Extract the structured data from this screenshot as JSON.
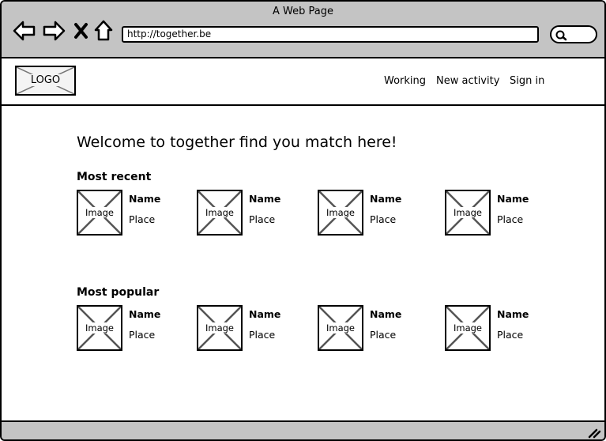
{
  "browser": {
    "title": "A Web Page",
    "url": "http://together.be",
    "icons": [
      "back-arrow-icon",
      "forward-arrow-icon",
      "close-x-icon",
      "home-icon",
      "search-icon",
      "resize-grip-icon"
    ]
  },
  "header": {
    "logo_text": "LOGO",
    "nav": [
      "Working",
      "New activity",
      "Sign in"
    ]
  },
  "main": {
    "headline": "Welcome to together find you match here!",
    "sections": [
      {
        "title": "Most recent",
        "cards": [
          {
            "image_label": "Image",
            "name": "Name",
            "place": "Place"
          },
          {
            "image_label": "Image",
            "name": "Name",
            "place": "Place"
          },
          {
            "image_label": "Image",
            "name": "Name",
            "place": "Place"
          },
          {
            "image_label": "Image",
            "name": "Name",
            "place": "Place"
          }
        ]
      },
      {
        "title": "Most popular",
        "cards": [
          {
            "image_label": "Image",
            "name": "Name",
            "place": "Place"
          },
          {
            "image_label": "Image",
            "name": "Name",
            "place": "Place"
          },
          {
            "image_label": "Image",
            "name": "Name",
            "place": "Place"
          },
          {
            "image_label": "Image",
            "name": "Name",
            "place": "Place"
          }
        ]
      }
    ]
  },
  "colors": {
    "chrome": "#c4c4c4",
    "border": "#000000",
    "placeholder_cross": "#555555"
  }
}
